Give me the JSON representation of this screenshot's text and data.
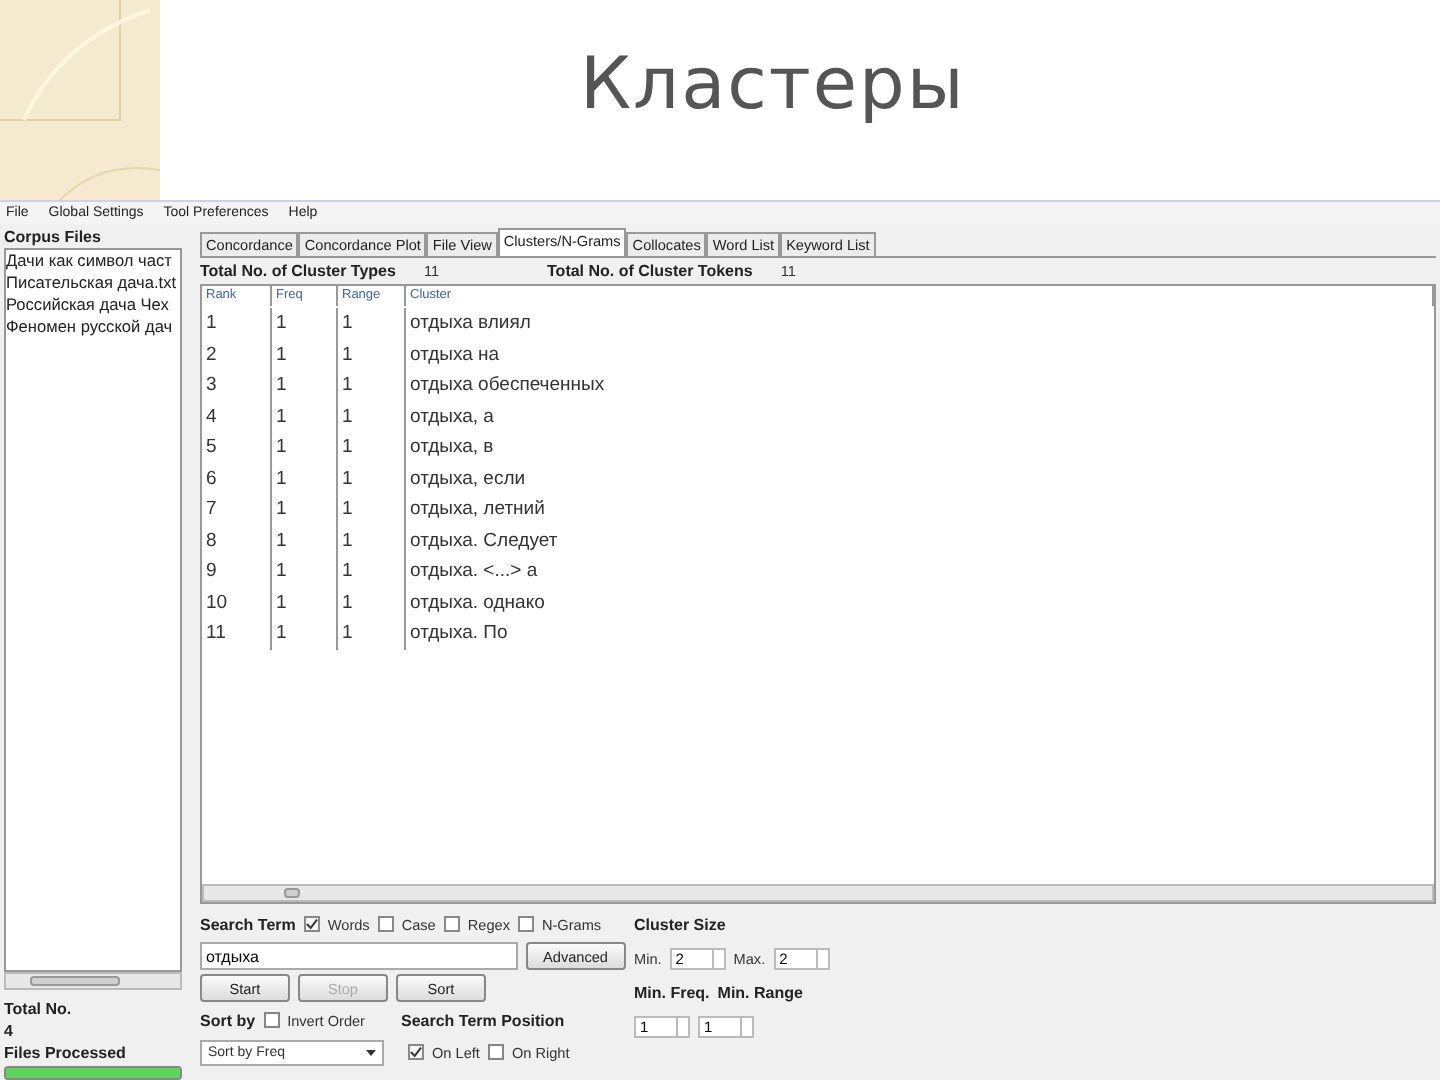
{
  "slide": {
    "title": "Кластеры"
  },
  "menu": [
    "File",
    "Global Settings",
    "Tool Preferences",
    "Help"
  ],
  "corpus": {
    "heading": "Corpus Files",
    "files": [
      "Дачи как символ част",
      "Писательская дача.txt",
      "Российская дача Чех",
      "Феномен русской дач"
    ],
    "total_label": "Total No.",
    "total": "4",
    "processed_label": "Files Processed",
    "progress": {
      "level": 1
    }
  },
  "tabs": [
    {
      "label": "Concordance",
      "selected": false
    },
    {
      "label": "Concordance Plot",
      "selected": false
    },
    {
      "label": "File View",
      "selected": false
    },
    {
      "label": "Clusters/N-Grams",
      "selected": true
    },
    {
      "label": "Collocates",
      "selected": false
    },
    {
      "label": "Word List",
      "selected": false
    },
    {
      "label": "Keyword List",
      "selected": false
    }
  ],
  "totals": [
    {
      "label": "Total No. of Cluster Types",
      "value": "11"
    },
    {
      "label": "Total No. of Cluster Tokens",
      "value": "11"
    }
  ],
  "table": {
    "columns": [
      "Rank",
      "Freq",
      "Range",
      "Cluster"
    ],
    "rows": [
      [
        "1",
        "1",
        "1",
        "отдыха влиял"
      ],
      [
        "2",
        "1",
        "1",
        "отдыха на"
      ],
      [
        "3",
        "1",
        "1",
        "отдыха обеспеченных"
      ],
      [
        "4",
        "1",
        "1",
        "отдыха, а"
      ],
      [
        "5",
        "1",
        "1",
        "отдыха, в"
      ],
      [
        "6",
        "1",
        "1",
        "отдыха, если"
      ],
      [
        "7",
        "1",
        "1",
        "отдыха, летний"
      ],
      [
        "8",
        "1",
        "1",
        "отдыха. Следует"
      ],
      [
        "9",
        "1",
        "1",
        "отдыха. <...> а"
      ],
      [
        "10",
        "1",
        "1",
        "отдыха. однако"
      ],
      [
        "11",
        "1",
        "1",
        "отдыха. По"
      ]
    ]
  },
  "search": {
    "label": "Search Term",
    "options": [
      {
        "label": "Words",
        "checked": true
      },
      {
        "label": "Case",
        "checked": false
      },
      {
        "label": "Regex",
        "checked": false
      },
      {
        "label": "N-Grams",
        "checked": false
      }
    ],
    "value": "отдыха",
    "advanced": "Advanced"
  },
  "buttons": [
    {
      "label": "Start",
      "disabled": false
    },
    {
      "label": "Stop",
      "disabled": true
    },
    {
      "label": "Sort",
      "disabled": false
    }
  ],
  "sort": {
    "label": "Sort by",
    "invert": {
      "label": "Invert Order",
      "checked": false
    },
    "value": "Sort by Freq"
  },
  "position": {
    "label": "Search Term Position",
    "options": [
      {
        "label": "On Left",
        "checked": true
      },
      {
        "label": "On Right",
        "checked": false
      }
    ]
  },
  "cluster_size": {
    "label": "Cluster Size",
    "min_label": "Min.",
    "min": "2",
    "max_label": "Max.",
    "max": "2"
  },
  "min_freq": {
    "label": "Min. Freq.",
    "value": "1"
  },
  "min_range": {
    "label": "Min. Range",
    "value": "1"
  }
}
